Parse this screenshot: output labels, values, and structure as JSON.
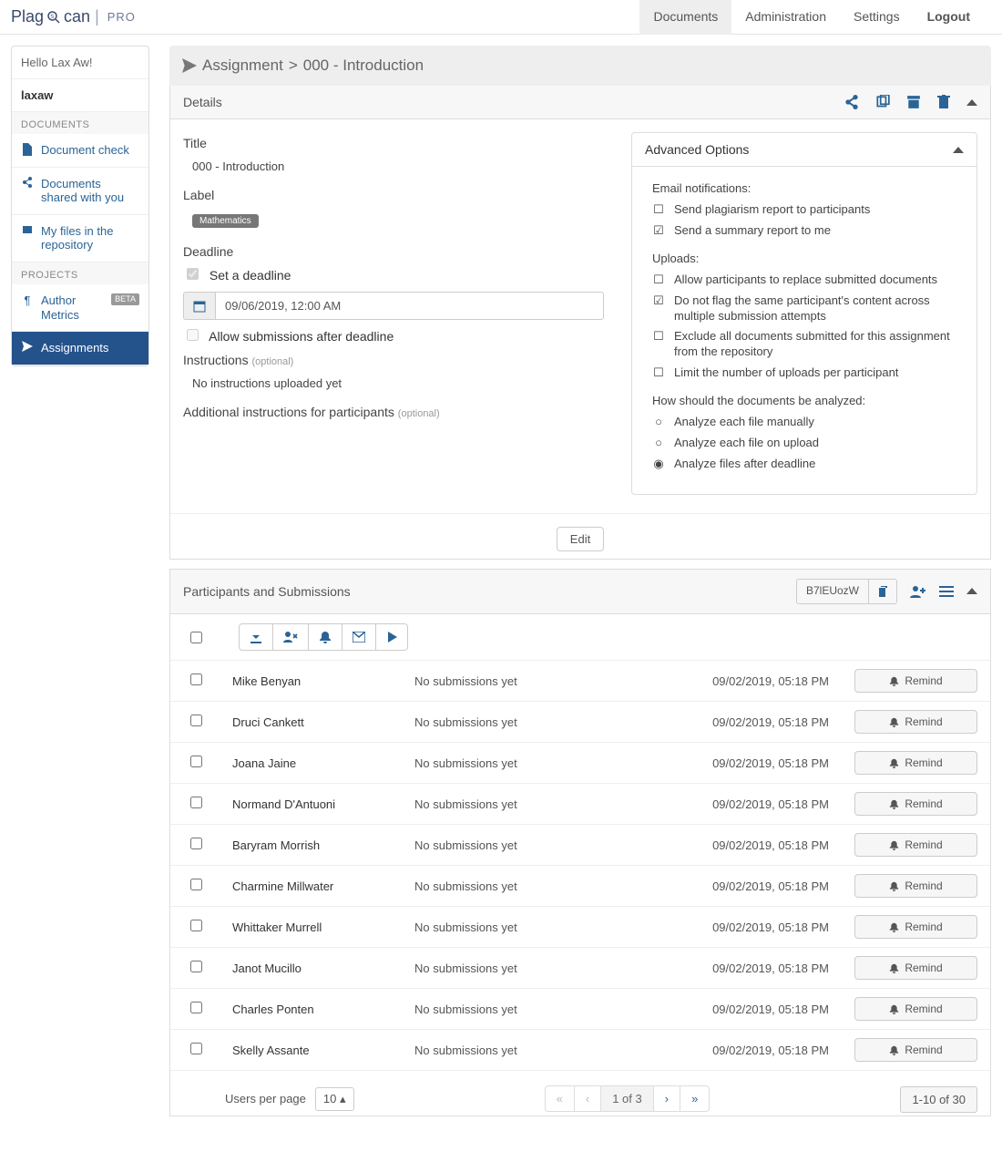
{
  "topbar": {
    "logo_main": "Plag",
    "logo_sub": "can",
    "logo_pro": "PRO",
    "tabs": {
      "documents": "Documents",
      "administration": "Administration",
      "settings": "Settings",
      "logout": "Logout"
    }
  },
  "sidebar": {
    "hello": "Hello Lax Aw!",
    "username": "laxaw",
    "head_documents": "DOCUMENTS",
    "doc_check": "Document check",
    "docs_shared": "Documents shared with you",
    "my_files": "My files in the repository",
    "head_projects": "PROJECTS",
    "author_metrics": "Author Metrics",
    "beta": "BETA",
    "assignments": "Assignments"
  },
  "crumb": {
    "assignment": "Assignment",
    "sep": ">",
    "name": "000 - Introduction"
  },
  "details": {
    "heading": "Details",
    "title_label": "Title",
    "title_value": "000 - Introduction",
    "label_label": "Label",
    "label_value": "Mathematics",
    "deadline_label": "Deadline",
    "set_deadline": "Set a deadline",
    "deadline_value": "09/06/2019, 12:00 AM",
    "allow_after": "Allow submissions after deadline",
    "instructions_label": "Instructions",
    "optional": "(optional)",
    "instructions_value": "No instructions uploaded yet",
    "additional_instr": "Additional instructions for participants"
  },
  "advanced": {
    "heading": "Advanced Options",
    "email_heading": "Email notifications:",
    "email_opt1": "Send plagiarism report to participants",
    "email_opt2": "Send a summary report to me",
    "uploads_heading": "Uploads:",
    "up_opt1": "Allow participants to replace submitted documents",
    "up_opt2": "Do not flag the same participant's content across multiple submission attempts",
    "up_opt3": "Exclude all documents submitted for this assignment from the repository",
    "up_opt4": "Limit the number of uploads per participant",
    "analyze_heading": "How should the documents be analyzed:",
    "an_opt1": "Analyze each file manually",
    "an_opt2": "Analyze each file on upload",
    "an_opt3": "Analyze files after deadline"
  },
  "edit_label": "Edit",
  "participants": {
    "heading": "Participants and Submissions",
    "code": "B7lEUozW",
    "no_sub": "No submissions yet",
    "remind_label": "Remind",
    "rows": [
      {
        "name": "Mike Benyan",
        "date": "09/02/2019, 05:18 PM"
      },
      {
        "name": "Druci Cankett",
        "date": "09/02/2019, 05:18 PM"
      },
      {
        "name": "Joana Jaine",
        "date": "09/02/2019, 05:18 PM"
      },
      {
        "name": "Normand D&#39;Antuoni",
        "date": "09/02/2019, 05:18 PM"
      },
      {
        "name": "Baryram Morrish",
        "date": "09/02/2019, 05:18 PM"
      },
      {
        "name": "Charmine Millwater",
        "date": "09/02/2019, 05:18 PM"
      },
      {
        "name": "Whittaker Murrell",
        "date": "09/02/2019, 05:18 PM"
      },
      {
        "name": "Janot Mucillo",
        "date": "09/02/2019, 05:18 PM"
      },
      {
        "name": "Charles Ponten",
        "date": "09/02/2019, 05:18 PM"
      },
      {
        "name": "Skelly Assante",
        "date": "09/02/2019, 05:18 PM"
      }
    ]
  },
  "pager": {
    "per_page_label": "Users per page",
    "per_page_value": "10",
    "first": "«",
    "prev": "‹",
    "current": "1 of 3",
    "next": "›",
    "last": "»",
    "range": "1-10 of 30"
  }
}
